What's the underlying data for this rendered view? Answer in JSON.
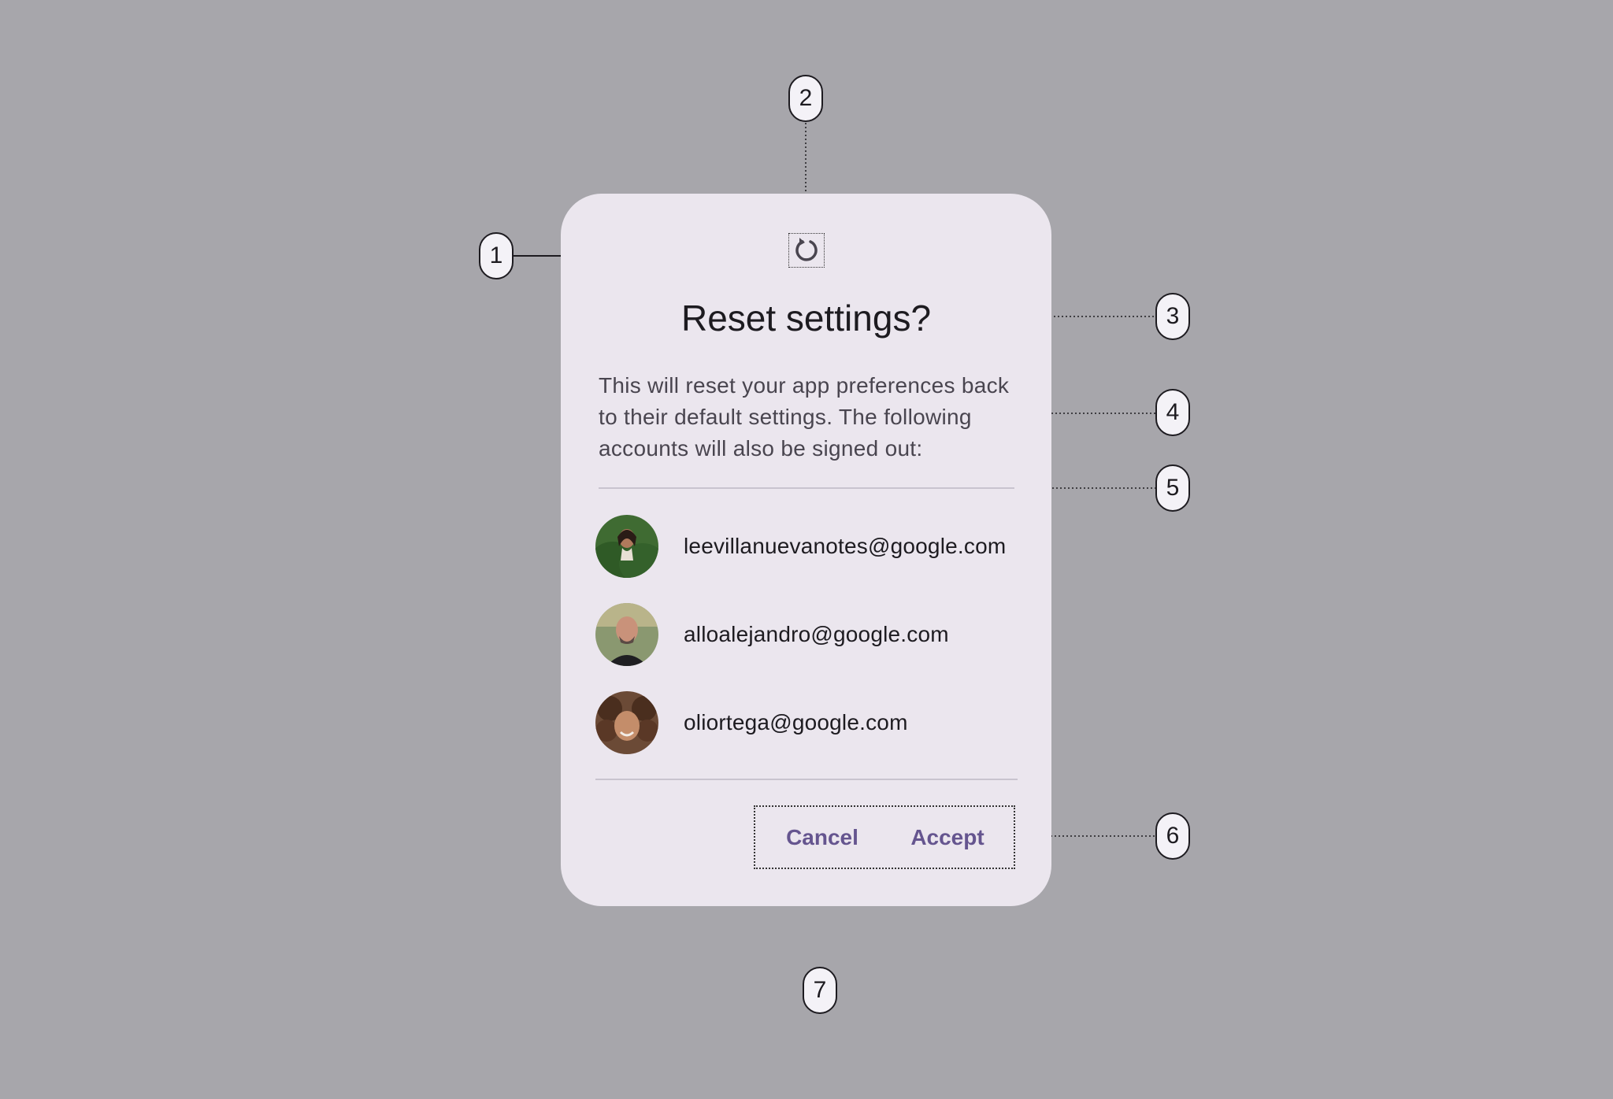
{
  "dialog": {
    "title": "Reset settings?",
    "icon": "reset-icon",
    "supporting_text": "This will reset your app preferences back to their default settings. The following accounts will also be signed out:",
    "accounts": [
      {
        "email": "leevillanuevanotes@google.com",
        "avatar": "avatar-woman-green-leaves"
      },
      {
        "email": "alloalejandro@google.com",
        "avatar": "avatar-bald-man"
      },
      {
        "email": "oliortega@google.com",
        "avatar": "avatar-curly-hair-child"
      }
    ],
    "actions": {
      "cancel_label": "Cancel",
      "accept_label": "Accept"
    }
  },
  "callouts": [
    "1",
    "2",
    "3",
    "4",
    "5",
    "6",
    "7"
  ],
  "colors": {
    "background": "#a7a6ab",
    "dialog_surface": "#ebe6ee",
    "primary": "#65558f",
    "on_surface": "#1d1b20",
    "on_surface_variant": "#49454f",
    "divider": "#c9c4cf"
  }
}
